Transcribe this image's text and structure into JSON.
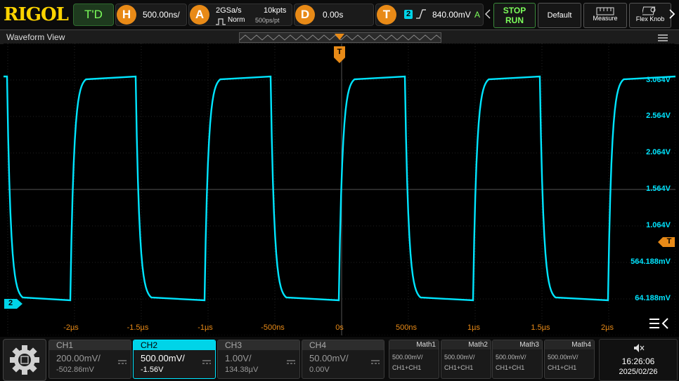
{
  "header": {
    "logo": "RIGOL",
    "mode": "T'D",
    "horizontal": {
      "label": "H",
      "value": "500.00ns/"
    },
    "acquire": {
      "label": "A",
      "rate": "2GSa/s",
      "mode": "Norm",
      "points": "10kpts",
      "per_pt": "500ps/pt"
    },
    "delay": {
      "label": "D",
      "value": "0.00s"
    },
    "trigger": {
      "label": "T",
      "channel": "2",
      "level": "840.00mV",
      "status": "A"
    },
    "stop_label": "STOP",
    "run_label": "RUN",
    "default_label": "Default",
    "measure_label": "Measure",
    "flex_label": "Flex Knob"
  },
  "waveform": {
    "title": "Waveform View",
    "trigger_marker": "T",
    "channel_marker": "2",
    "y_labels": [
      "3.064V",
      "2.564V",
      "2.064V",
      "1.564V",
      "1.064V",
      "564.188mV",
      "64.188mV"
    ],
    "x_labels": [
      "-2µs",
      "-1.5µs",
      "-1µs",
      "-500ns",
      "0s",
      "500ns",
      "1µs",
      "1.5µs",
      "2µs"
    ],
    "trace_color": "#00e5ff",
    "accent_color": "#e88a17"
  },
  "channels": [
    {
      "name": "CH1",
      "scale": "200.00mV/",
      "offset": "-502.86mV"
    },
    {
      "name": "CH2",
      "scale": "500.00mV/",
      "offset": "-1.56V"
    },
    {
      "name": "CH3",
      "scale": "1.00V/",
      "offset": "134.38µV"
    },
    {
      "name": "CH4",
      "scale": "50.00mV/",
      "offset": "0.00V"
    }
  ],
  "maths": [
    {
      "name": "Math1",
      "scale": "500.00mV/",
      "expr": "CH1+CH1"
    },
    {
      "name": "Math2",
      "scale": "500.00mV/",
      "expr": "CH1+CH1"
    },
    {
      "name": "Math3",
      "scale": "500.00mV/",
      "expr": "CH1+CH1"
    },
    {
      "name": "Math4",
      "scale": "500.00mV/",
      "expr": "CH1+CH1"
    }
  ],
  "status": {
    "time": "16:26:06",
    "date": "2025/02/26"
  }
}
